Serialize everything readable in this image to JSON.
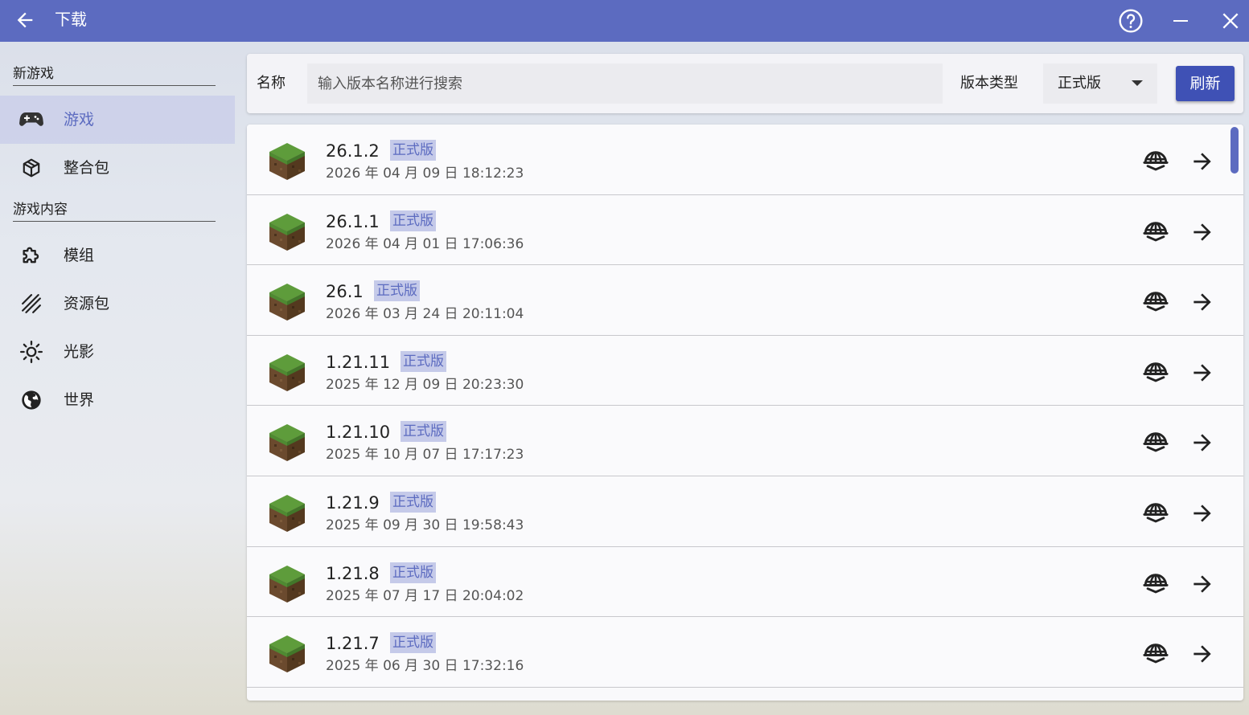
{
  "titlebar": {
    "title": "下载",
    "back_icon": "arrow-left-icon",
    "help_icon": "help-circle-icon",
    "minimize_icon": "minimize-icon",
    "close_icon": "close-icon"
  },
  "sidebar": {
    "section_new_game": "新游戏",
    "section_game_content": "游戏内容",
    "items": [
      {
        "label": "游戏",
        "icon": "gamepad-icon",
        "active": true
      },
      {
        "label": "整合包",
        "icon": "package-icon",
        "active": false
      },
      {
        "label": "模组",
        "icon": "puzzle-icon",
        "active": false
      },
      {
        "label": "资源包",
        "icon": "texture-icon",
        "active": false
      },
      {
        "label": "光影",
        "icon": "sun-icon",
        "active": false
      },
      {
        "label": "世界",
        "icon": "globe-icon",
        "active": false
      }
    ]
  },
  "search": {
    "name_label": "名称",
    "placeholder": "输入版本名称进行搜索",
    "type_label": "版本类型",
    "type_value": "正式版",
    "refresh_label": "刷新"
  },
  "versions": [
    {
      "version": "26.1.2",
      "tag": "正式版",
      "date": "2026 年 04 月 09 日 18:12:23"
    },
    {
      "version": "26.1.1",
      "tag": "正式版",
      "date": "2026 年 04 月 01 日 17:06:36"
    },
    {
      "version": "26.1",
      "tag": "正式版",
      "date": "2026 年 03 月 24 日 20:11:04"
    },
    {
      "version": "1.21.11",
      "tag": "正式版",
      "date": "2025 年 12 月 09 日 20:23:30"
    },
    {
      "version": "1.21.10",
      "tag": "正式版",
      "date": "2025 年 10 月 07 日 17:17:23"
    },
    {
      "version": "1.21.9",
      "tag": "正式版",
      "date": "2025 年 09 月 30 日 19:58:43"
    },
    {
      "version": "1.21.8",
      "tag": "正式版",
      "date": "2025 年 07 月 17 日 20:04:02"
    },
    {
      "version": "1.21.7",
      "tag": "正式版",
      "date": "2025 年 06 月 30 日 17:32:16"
    }
  ],
  "colors": {
    "accent": "#5c6bc0",
    "button": "#3f51b5",
    "tag_bg": "#c5cae9"
  }
}
